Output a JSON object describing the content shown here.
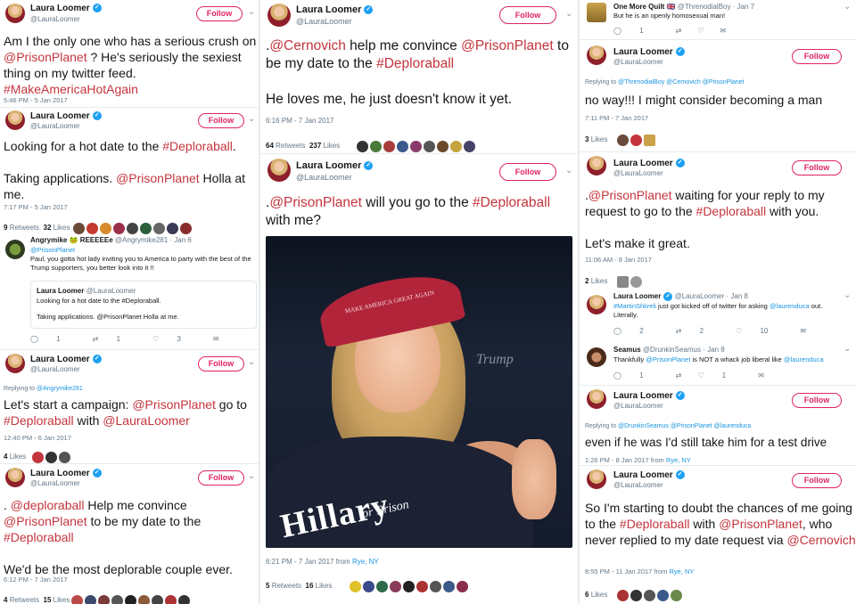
{
  "common": {
    "name": "Laura Loomer",
    "handle": "@LauraLoomer",
    "follow": "Follow",
    "verified_glyph": "✓",
    "caret": "⌄"
  },
  "colors": {
    "link": "#c4353d",
    "follow": "#e0245e",
    "verified": "#1da1f2",
    "muted": "#657786"
  },
  "col1": {
    "t1": {
      "text_a": "Am I the only one who has a serious crush on ",
      "link1": "@PrisonPlanet",
      "text_b": " ? He's seriously the sexiest thing on my twitter feed. ",
      "link2": "#MakeAmericaHotAgain",
      "time": "5:46 PM - 5 Jan 2017"
    },
    "t2": {
      "text_a": "Looking for a hot date to the ",
      "link1": "#Deploraball",
      "text_b": ".\n\nTaking applications. ",
      "link2": "@PrisonPlanet",
      "text_c": " Holla at me.",
      "time": "7:17 PM - 5 Jan 2017",
      "retweets_n": "9",
      "retweets_label": "Retweets",
      "likes_n": "32",
      "likes_label": "Likes",
      "reply": {
        "name": "Angrymike",
        "badge": "🐸",
        "name2": "REEEEEe",
        "handle": "@Angrymike281 · Jan 6",
        "to": "@PrisonPlanet",
        "text": "Paul, you gotta hot lady inviting you to America to party with the best of the Trump supporters, you better look into it !!",
        "quote_name": "Laura Loomer",
        "quote_handle": "@LauraLoomer",
        "quote_line1": "Looking for a hot date to the #Deploraball.",
        "quote_line2": "Taking applications. @PrisonPlanet Holla at me.",
        "reply_n": "1",
        "rt_n": "1",
        "like_n": "3"
      }
    },
    "t3": {
      "replying_label": "Replying to ",
      "replying_to": "@Angrymike281",
      "text_a": "Let's start a campaign: ",
      "link1": "@PrisonPlanet",
      "text_b": " go to ",
      "link2": "#Deploraball",
      "text_c": " with ",
      "link3": "@LauraLoomer",
      "time": "12:40 PM - 6 Jan 2017",
      "likes_n": "4",
      "likes_label": "Likes"
    },
    "t4": {
      "text_a": ". ",
      "link1": "@deploraball",
      "text_b": " Help me convince ",
      "link2": "@PrisonPlanet",
      "text_c": " to be my date to the ",
      "link3": "#Deploraball",
      "text_d": "\n\nWe'd be the most deplorable couple ever.",
      "time": "6:12 PM - 7 Jan 2017",
      "retweets_n": "4",
      "retweets_label": "Retweets",
      "likes_n": "15",
      "likes_label": "Likes"
    }
  },
  "col2": {
    "t1": {
      "text_a": ".",
      "link1": "@Cernovich",
      "text_b": " help me convince ",
      "link2": "@PrisonPlanet",
      "text_c": " to be my date to the ",
      "link3": "#Deploraball",
      "text_d": "\n\nHe loves me, he just doesn't know it yet.",
      "time": "6:16 PM - 7 Jan 2017",
      "retweets_n": "64",
      "retweets_label": "Retweets",
      "likes_n": "237",
      "likes_label": "Likes"
    },
    "t2": {
      "text_a": ".",
      "link1": "@PrisonPlanet",
      "text_b": " will you go to the ",
      "link2": "#Deploraball",
      "text_c": " with me?",
      "photo_cap": "MAKE AMERICA GREAT AGAIN",
      "photo_sign": "Trump",
      "photo_shirt": "Hillary",
      "photo_shirt_sub": "for Prison",
      "time": "6:21 PM - 7 Jan 2017 from ",
      "place": "Rye, NY",
      "retweets_n": "5",
      "retweets_label": "Retweets",
      "likes_n": "16",
      "likes_label": "Likes"
    }
  },
  "col3": {
    "top": {
      "name": "One More Quilt",
      "flag": "🇬🇧",
      "handle": "@ThrenodialBoy · Jan 7",
      "text": "But he is an openly homosexual man!",
      "reply_n": "1"
    },
    "t1": {
      "replying_label": "Replying to ",
      "replying_to": "@ThrenodialBoy @Cernovich @PrisonPlanet",
      "text": "no way!!! I might consider becoming a man",
      "time": "7:11 PM - 7 Jan 2017",
      "likes_n": "3",
      "likes_label": "Likes"
    },
    "t2": {
      "text_a": ".",
      "link1": "@PrisonPlanet",
      "text_b": " waiting for your reply to my request to go to the ",
      "link2": "#Deploraball",
      "text_c": " with you.\n\nLet's make it great.",
      "time": "11:06 AM - 8 Jan 2017",
      "likes_n": "2",
      "likes_label": "Likes",
      "r1": {
        "name": "Laura Loomer",
        "handle": "@LauraLoomer · Jan 8",
        "link1": "#MartinShkreli",
        "text_a": " just got kicked off of twitter for asking ",
        "link2": "@laurenduca",
        "text_b": " out. Literally.",
        "reply_n": "2",
        "rt_n": "2",
        "like_n": "10"
      },
      "r2": {
        "name": "Seamus",
        "handle": "@DrunkinSeamus · Jan 8",
        "text_a": "Thankfully ",
        "link1": "@PrisonPlanet",
        "text_b": " is NOT a whack job liberal like ",
        "link2": "@laurenduca",
        "reply_n": "1",
        "like_n": "1"
      }
    },
    "t3": {
      "replying_label": "Replying to ",
      "replying_to": "@DrunkinSeamus @PrisonPlanet @laurenduca",
      "text": "even if he was I'd still take him for a test drive",
      "time": "1:26 PM - 8 Jan 2017 from ",
      "place": "Rye, NY"
    },
    "t4": {
      "text_a": "So I'm starting to doubt the chances of me going to the ",
      "link1": "#Deploraball",
      "text_b": " with ",
      "link2": "@PrisonPlanet",
      "text_c": ", who never replied to my date request via ",
      "link3": "@Cernovich",
      "time": "8:55 PM - 11 Jan 2017 from ",
      "place": "Rye, NY",
      "likes_n": "6",
      "likes_label": "Likes"
    }
  },
  "icons": [
    "verified-badge-icon",
    "chevron-down-icon",
    "reply-icon",
    "retweet-icon",
    "like-icon",
    "dm-icon"
  ],
  "action_glyphs": {
    "reply": "◯",
    "retweet": "⇄",
    "like": "♡",
    "dm": "✉"
  }
}
